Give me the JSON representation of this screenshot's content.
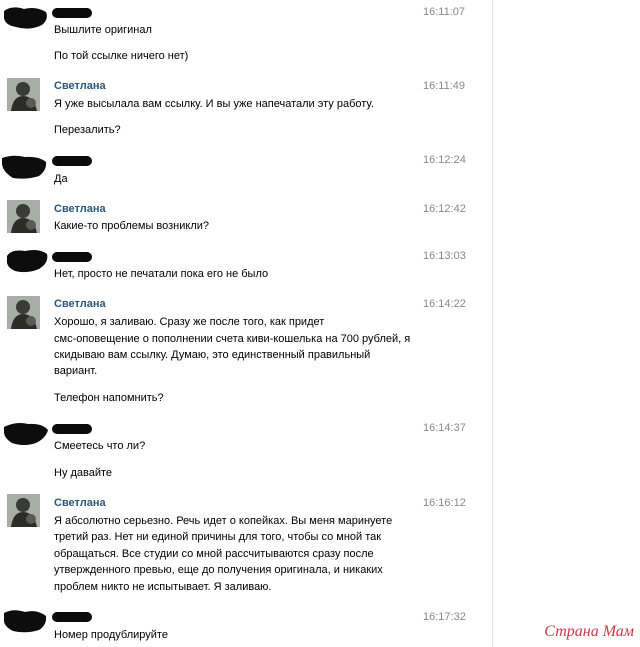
{
  "watermark": "Страна Мам",
  "messages": [
    {
      "sender": "",
      "time": "16:11:07",
      "lines": [
        "Вышлите оригинал",
        "По той ссылке ничего нет)"
      ]
    },
    {
      "sender": "Светлана",
      "time": "16:11:49",
      "lines": [
        "Я уже высылала вам ссылку. И вы уже напечатали эту работу.",
        "Перезалить?"
      ]
    },
    {
      "sender": "",
      "time": "16:12:24",
      "lines": [
        "Да"
      ]
    },
    {
      "sender": "Светлана",
      "time": "16:12:42",
      "lines": [
        "Какие-то проблемы возникли?"
      ]
    },
    {
      "sender": "",
      "time": "16:13:03",
      "lines": [
        "Нет, просто не печатали пока его не было"
      ]
    },
    {
      "sender": "Светлана",
      "time": "16:14:22",
      "lines": [
        "Хорошо, я заливаю. Сразу же после того, как придет",
        "смс-оповещение о пополнении счета киви-кошелька на 700 рублей, я",
        "скидываю вам ссылку. Думаю, это единственный правильный",
        "вариант.",
        "Телефон напомнить?"
      ]
    },
    {
      "sender": "",
      "time": "16:14:37",
      "lines": [
        "Смеетесь что ли?",
        "Ну давайте"
      ]
    },
    {
      "sender": "Светлана",
      "time": "16:16:12",
      "lines": [
        "Я абсолютно серьезно. Речь идет о копейках. Вы меня маринуете",
        "третий раз. Нет ни единой причины для того, чтобы со мной так",
        "обращаться. Все студии со мной рассчитываются сразу после",
        "утвержденного превью, еще до получения оригинала, и никаких",
        "проблем никто не испытывает. Я заливаю."
      ]
    },
    {
      "sender": "",
      "time": "16:17:32",
      "lines": [
        "Номер продублируйте"
      ]
    }
  ]
}
